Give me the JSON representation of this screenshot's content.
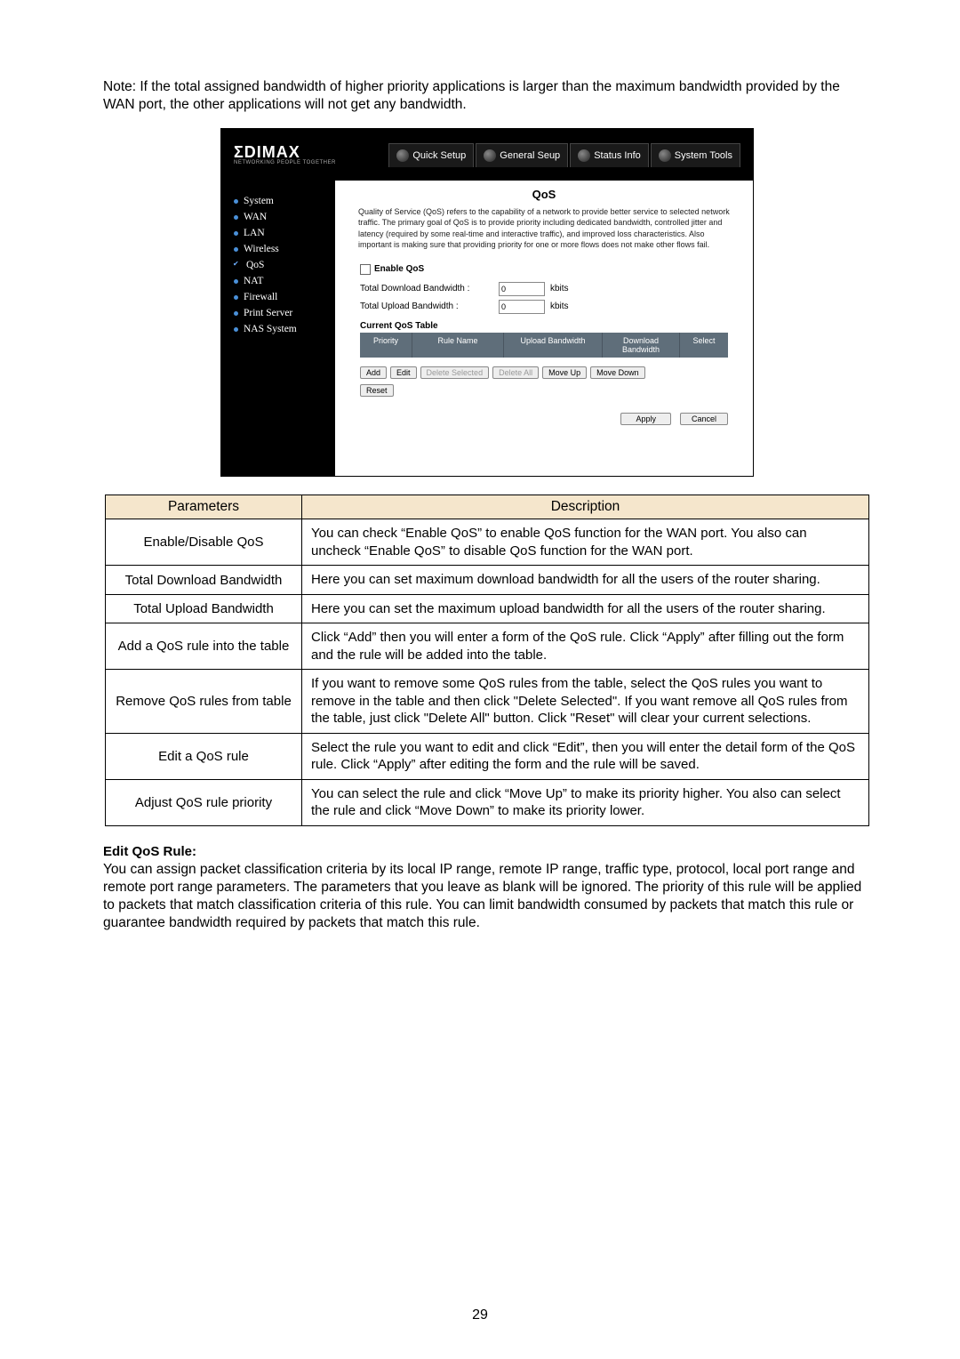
{
  "note": "Note: If the total assigned bandwidth of higher priority applications is larger than the maximum bandwidth provided by the WAN port, the other applications will not get any bandwidth.",
  "router": {
    "logo": "ΣDIMAX",
    "logo_sub": "NETWORKING PEOPLE TOGETHER",
    "tabs": [
      "Quick Setup",
      "General Seup",
      "Status Info",
      "System Tools"
    ],
    "side": [
      {
        "label": "System",
        "sel": false
      },
      {
        "label": "WAN",
        "sel": false
      },
      {
        "label": "LAN",
        "sel": false
      },
      {
        "label": "Wireless",
        "sel": false
      },
      {
        "label": "QoS",
        "sel": true
      },
      {
        "label": "NAT",
        "sel": false
      },
      {
        "label": "Firewall",
        "sel": false
      },
      {
        "label": "Print Server",
        "sel": false
      },
      {
        "label": "NAS System",
        "sel": false
      }
    ],
    "panel_title": "QoS",
    "panel_desc": "Quality of Service (QoS) refers to the capability of a network to provide better service to selected network traffic. The primary goal of QoS is to provide priority including dedicated bandwidth, controlled jitter and latency (required by some real-time and interactive traffic), and improved loss characteristics. Also important is making sure that providing priority for one or more flows does not make other flows fail.",
    "enable_label": "Enable QoS",
    "dl_label": "Total Download Bandwidth :",
    "ul_label": "Total Upload Bandwidth :",
    "val0": "0",
    "unit": "kbits",
    "current_table": "Current QoS Table",
    "cols": [
      "Priority",
      "Rule Name",
      "Upload Bandwidth",
      "Download Bandwidth",
      "Select"
    ],
    "btns": {
      "add": "Add",
      "edit": "Edit",
      "del_sel": "Delete Selected",
      "del_all": "Delete All",
      "mv_up": "Move Up",
      "mv_dn": "Move Down",
      "reset": "Reset",
      "apply": "Apply",
      "cancel": "Cancel"
    }
  },
  "ptable": {
    "h1": "Parameters",
    "h2": "Description",
    "rows": [
      {
        "p": "Enable/Disable QoS",
        "d": "You can check “Enable QoS” to enable QoS function for the WAN port. You also can uncheck “Enable QoS” to disable QoS function for the WAN port."
      },
      {
        "p": "Total Download Bandwidth",
        "d": "Here you can set maximum download bandwidth for all the users of the router sharing."
      },
      {
        "p": "Total Upload Bandwidth",
        "d": "Here you can set the maximum upload bandwidth for all the users of the router sharing."
      },
      {
        "p": "Add a QoS rule into the table",
        "d": "Click “Add” then you will enter a form of the QoS rule. Click “Apply” after filling out the form and the rule will be added into the table."
      },
      {
        "p": "Remove QoS rules from table",
        "d": "If you want to remove some QoS rules from the table, select the QoS rules you want to remove in the table and then click \"Delete Selected\". If you want remove all QoS rules from the table, just click \"Delete All\" button. Click \"Reset\" will clear your current selections."
      },
      {
        "p": "Edit a QoS rule",
        "d": "Select the rule you want to edit and click “Edit”, then you will enter the detail form of the QoS rule. Click “Apply” after editing the form and the rule will be saved."
      },
      {
        "p": "Adjust QoS rule priority",
        "d": "You can select the rule and click “Move Up” to make its priority higher. You also can select the rule and click “Move Down” to make its priority lower."
      }
    ]
  },
  "edit": {
    "head": "Edit QoS Rule:",
    "body": "You can assign packet classification criteria by its local IP range, remote IP range, traffic type, protocol, local port range and remote port range parameters. The parameters that you leave as blank will be ignored. The priority of this rule will be applied to packets that match classification criteria of this rule. You can limit bandwidth consumed by packets that match this rule or guarantee bandwidth required by packets that match this rule."
  },
  "page_num": "29"
}
